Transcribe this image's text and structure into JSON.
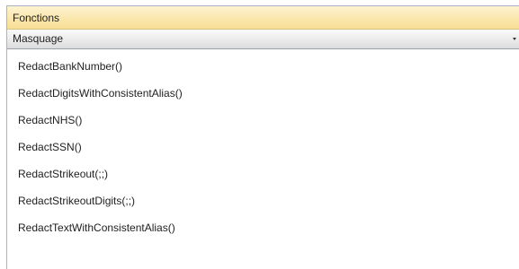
{
  "panel": {
    "header_label": "Fonctions"
  },
  "category_select": {
    "selected": "Masquage"
  },
  "functions": [
    "RedactBankNumber()",
    "RedactDigitsWithConsistentAlias()",
    "RedactNHS()",
    "RedactSSN()",
    "RedactStrikeout(;;)",
    "RedactStrikeoutDigits(;;)",
    "RedactTextWithConsistentAlias()"
  ],
  "colors": {
    "header_gradient_top": "#fdf3d0",
    "header_gradient_bottom": "#f8de95",
    "panel_border": "#a9b3c1"
  }
}
